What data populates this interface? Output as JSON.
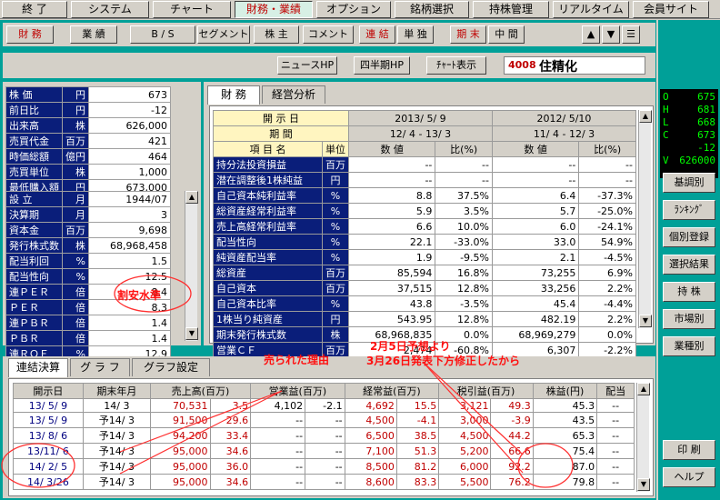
{
  "menu": [
    "終 了",
    "システム",
    "チャート",
    "財務・業績",
    "オプション",
    "銘柄選択",
    "持株管理",
    "リアルタイム",
    "会員サイト"
  ],
  "subtabs": [
    "財 務",
    "業 績",
    "B / S",
    "セグメント",
    "株 主",
    "コメント",
    "連 結",
    "単 独",
    "期 末",
    "中 間"
  ],
  "toolbar": {
    "news": "ニュースHP",
    "quarter": "四半期HP",
    "chart": "ﾁｬｰﾄ表示",
    "code": "4008",
    "name": "住精化"
  },
  "stock_info": [
    [
      "株 価",
      "円",
      "673"
    ],
    [
      "前日比",
      "円",
      "-12"
    ],
    [
      "出来高",
      "株",
      "626,000"
    ],
    [
      "売買代金",
      "百万",
      "421"
    ],
    [
      "時価総額",
      "億円",
      "464"
    ],
    [
      "売買単位",
      "株",
      "1,000"
    ],
    [
      "最低購入額",
      "円",
      "673,000"
    ]
  ],
  "company_info": [
    [
      "設 立",
      "月",
      "1944/07"
    ],
    [
      "決算期",
      "月",
      "3"
    ],
    [
      "資本金",
      "百万",
      "9,698"
    ],
    [
      "発行株式数",
      "株",
      "68,968,458"
    ],
    [
      "配当利回",
      "%",
      "1.5"
    ],
    [
      "配当性向",
      "%",
      "12.5"
    ],
    [
      "連ＰＥＲ",
      "倍",
      "8.4"
    ],
    [
      "ＰＥＲ",
      "倍",
      "8.3"
    ],
    [
      "連ＰＢＲ",
      "倍",
      "1.4"
    ],
    [
      "ＰＢＲ",
      "倍",
      "1.4"
    ],
    [
      "連ＲＯＥ",
      "%",
      "12.9"
    ]
  ],
  "fin_tabs": [
    "財 務",
    "経営分析"
  ],
  "fin_header": {
    "kaiji": "開 示 日",
    "kikan": "期 間",
    "komoku": "項 目 名",
    "tani": "単位",
    "d1": "2013/ 5/ 9",
    "p1": "12/ 4 - 13/ 3",
    "d2": "2012/ 5/10",
    "p2": "11/ 4 - 12/ 3",
    "val": "数 値",
    "ratio": "比(%)"
  },
  "fin_rows": [
    [
      "持分法投資損益",
      "百万",
      "--",
      "--",
      "--",
      "--"
    ],
    [
      "潜在調整後1株純益",
      "円",
      "--",
      "--",
      "--",
      "--"
    ],
    [
      "自己資本純利益率",
      "%",
      "8.8",
      "37.5%",
      "6.4",
      "-37.3%"
    ],
    [
      "総資産経常利益率",
      "%",
      "5.9",
      "3.5%",
      "5.7",
      "-25.0%"
    ],
    [
      "売上高経常利益率",
      "%",
      "6.6",
      "10.0%",
      "6.0",
      "-24.1%"
    ],
    [
      "配当性向",
      "%",
      "22.1",
      "-33.0%",
      "33.0",
      "54.9%"
    ],
    [
      "純資産配当率",
      "%",
      "1.9",
      "-9.5%",
      "2.1",
      "-4.5%"
    ],
    [
      "総資産",
      "百万",
      "85,594",
      "16.8%",
      "73,255",
      "6.9%"
    ],
    [
      "自己資本",
      "百万",
      "37,515",
      "12.8%",
      "33,256",
      "2.2%"
    ],
    [
      "自己資本比率",
      "%",
      "43.8",
      "-3.5%",
      "45.4",
      "-4.4%"
    ],
    [
      "1株当り純資産",
      "円",
      "543.95",
      "12.8%",
      "482.19",
      "2.2%"
    ],
    [
      "期末発行株式数",
      "株",
      "68,968,835",
      "0.0%",
      "68,969,279",
      "0.0%"
    ],
    [
      "営業ＣＦ",
      "百万",
      "2,474",
      "-60.8%",
      "6,307",
      "-2.2%"
    ]
  ],
  "bottom_tabs": [
    "連結決算",
    "グ ラ フ",
    "グラフ設定"
  ],
  "bottom_header": [
    "開示日",
    "期末年月",
    "売上高(百万)",
    "営業益(百万)",
    "経常益(百万)",
    "税引益(百万)",
    "株益(円)",
    "配当"
  ],
  "bottom_rows": [
    [
      "13/ 5/ 9",
      "14/ 3",
      "70,531",
      "3.5",
      "4,102",
      "-2.1",
      "4,692",
      "15.5",
      "3,121",
      "49.3",
      "45.3",
      "--"
    ],
    [
      "13/ 5/ 9",
      "予14/ 3",
      "91,500",
      "29.6",
      "--",
      "--",
      "4,500",
      "-4.1",
      "3,000",
      "-3.9",
      "43.5",
      "--"
    ],
    [
      "13/ 8/ 6",
      "予14/ 3",
      "94,200",
      "33.4",
      "--",
      "--",
      "6,500",
      "38.5",
      "4,500",
      "44.2",
      "65.3",
      "--"
    ],
    [
      "13/11/ 6",
      "予14/ 3",
      "95,000",
      "34.6",
      "--",
      "--",
      "7,100",
      "51.3",
      "5,200",
      "66.6",
      "75.4",
      "--"
    ],
    [
      "14/ 2/ 5",
      "予14/ 3",
      "95,000",
      "36.0",
      "--",
      "--",
      "8,500",
      "81.2",
      "6,000",
      "92.2",
      "87.0",
      "--"
    ],
    [
      "14/ 3/26",
      "予14/ 3",
      "95,000",
      "34.6",
      "--",
      "--",
      "8,600",
      "83.3",
      "5,500",
      "76.2",
      "79.8",
      "--"
    ]
  ],
  "ticker": [
    [
      "O",
      "675"
    ],
    [
      "H",
      "681"
    ],
    [
      "L",
      "668"
    ],
    [
      "C",
      "673"
    ],
    [
      "",
      "-12"
    ],
    [
      "V",
      "626000"
    ]
  ],
  "side_buttons": [
    "基調別",
    "ﾗﾝｷﾝｸﾞ",
    "個別登録",
    "選択結果",
    "持 株",
    "市場別",
    "業種別",
    "印 刷",
    "ヘルプ"
  ],
  "annotations": {
    "cheap": "割安水準",
    "reason": "売られた理由",
    "note1": "2月5日予想より",
    "note2": "3月26日発表下方修正したから"
  },
  "colors": {
    "teal": "#00a098",
    "navy": "#0a1e7a",
    "annot": "#ff1010"
  }
}
